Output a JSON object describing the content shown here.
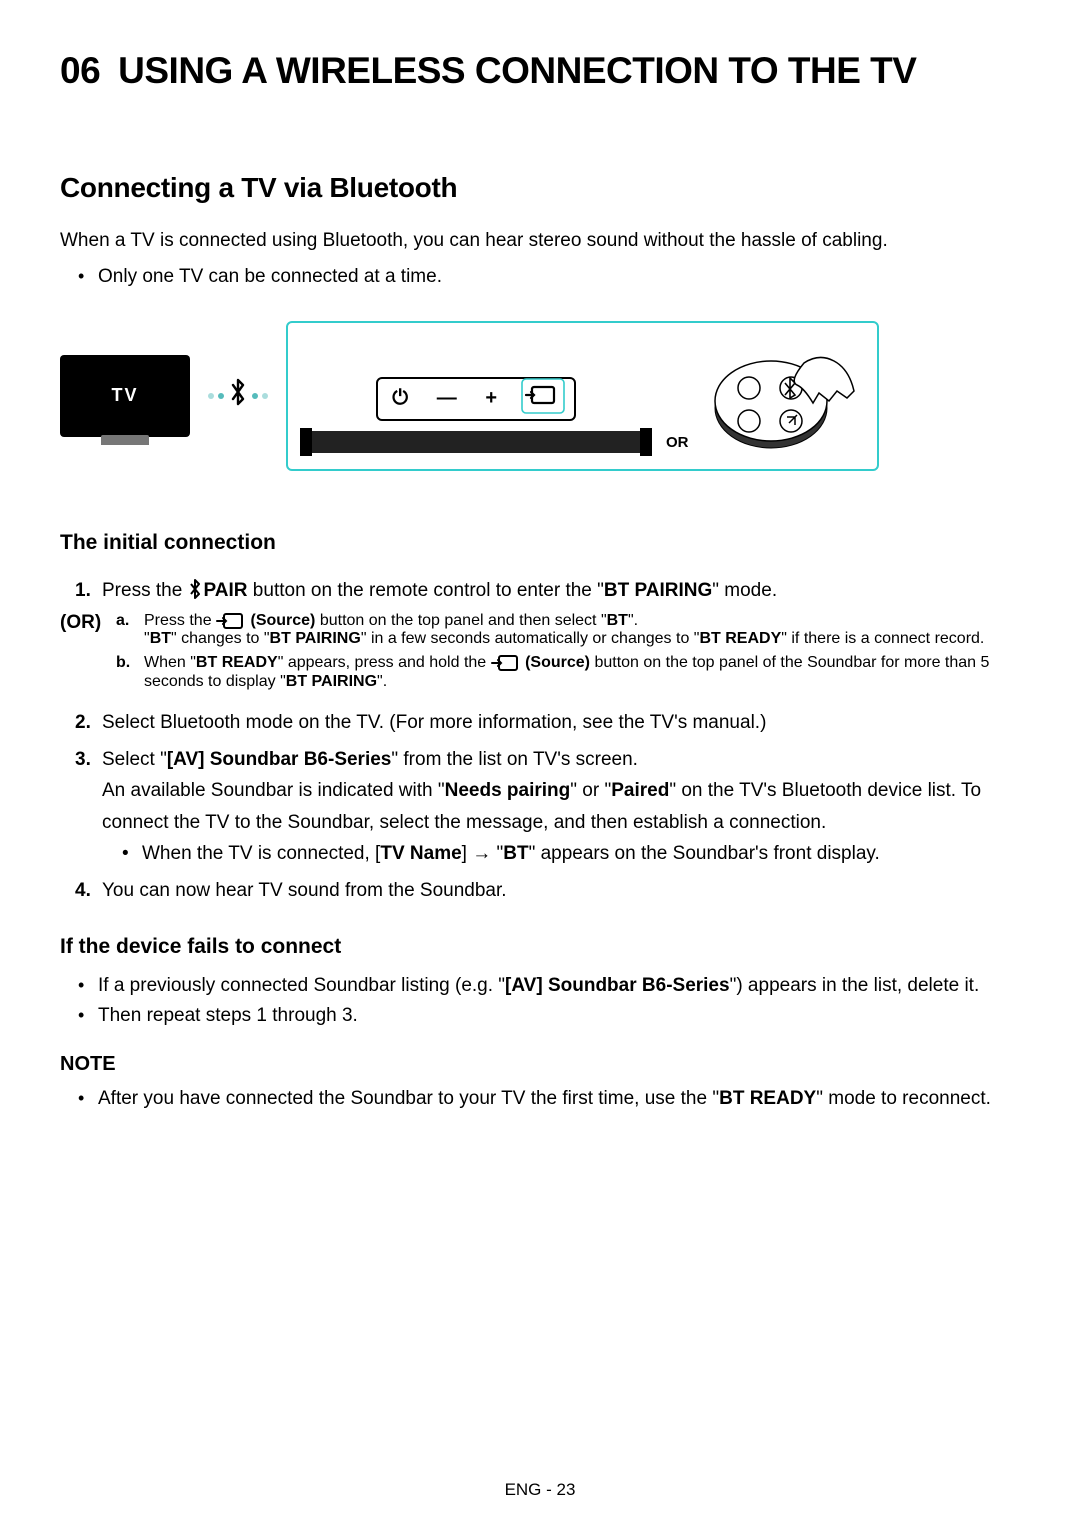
{
  "chapter": {
    "num": "06",
    "title": "USING A WIRELESS CONNECTION TO THE TV"
  },
  "section": {
    "title": "Connecting a TV via Bluetooth"
  },
  "intro": "When a TV is connected using Bluetooth, you can hear stereo sound without the hassle of cabling.",
  "intro_bullets": [
    "Only one TV can be connected at a time."
  ],
  "diagram": {
    "tv_label": "TV",
    "panel_symbols": {
      "power": "⏻",
      "minus": "—",
      "plus": "+",
      "source": "src"
    },
    "or_label": "OR"
  },
  "initial_heading": "The initial connection",
  "step1": {
    "pre": "Press the ",
    "pair_label": "PAIR",
    "mid": " button on the remote control to enter the \"",
    "bt_pairing": "BT PAIRING",
    "post": "\" mode."
  },
  "or_label": "(OR)",
  "sub_a": {
    "pre": "Press the ",
    "src_btn": "(Source)",
    "mid": " button on the top panel and then select \"",
    "bt": "BT",
    "post": "\".",
    "line2_pre": "\"",
    "line2_bt": "BT",
    "line2_mid": "\" changes to \"",
    "line2_pairing": "BT PAIRING",
    "line2_mid2": "\" in a few seconds automatically or changes to \"",
    "line2_ready": "BT READY",
    "line2_post": "\" if there is a connect record."
  },
  "sub_b": {
    "pre": "When \"",
    "ready": "BT READY",
    "mid": "\" appears, press and hold the ",
    "src_btn": "(Source)",
    "mid2": " button on the top panel of the Soundbar for more than 5 seconds to display \"",
    "pairing": "BT PAIRING",
    "post": "\"."
  },
  "step2": "Select Bluetooth mode on the TV. (For more information, see the TV's manual.)",
  "step3": {
    "pre": "Select \"",
    "device": "[AV] Soundbar B6-Series",
    "mid": "\" from the list on TV's screen.",
    "line2_pre": "An available Soundbar is indicated with \"",
    "needs": "Needs pairing",
    "line2_mid": "\" or \"",
    "paired": "Paired",
    "line2_post": "\" on the TV's Bluetooth device list. To connect the TV to the Soundbar, select the message, and then establish a connection.",
    "bullet_pre": "When the TV is connected, [",
    "tvname": "TV Name",
    "bullet_mid": "] → \"",
    "bt": "BT",
    "bullet_post": "\" appears on the Soundbar's front display."
  },
  "step4": "You can now hear TV sound from the Soundbar.",
  "fail_heading": "If the device fails to connect",
  "fail_bullets": {
    "b1_pre": "If a previously connected Soundbar listing (e.g. \"",
    "b1_device": "[AV] Soundbar B6-Series",
    "b1_post": "\") appears in the list, delete it.",
    "b2": "Then repeat steps 1 through 3."
  },
  "note_heading": "NOTE",
  "note": {
    "pre": "After you have connected the Soundbar to your TV the first time, use the \"",
    "ready": "BT READY",
    "post": "\" mode to reconnect."
  },
  "footer": "ENG - 23"
}
